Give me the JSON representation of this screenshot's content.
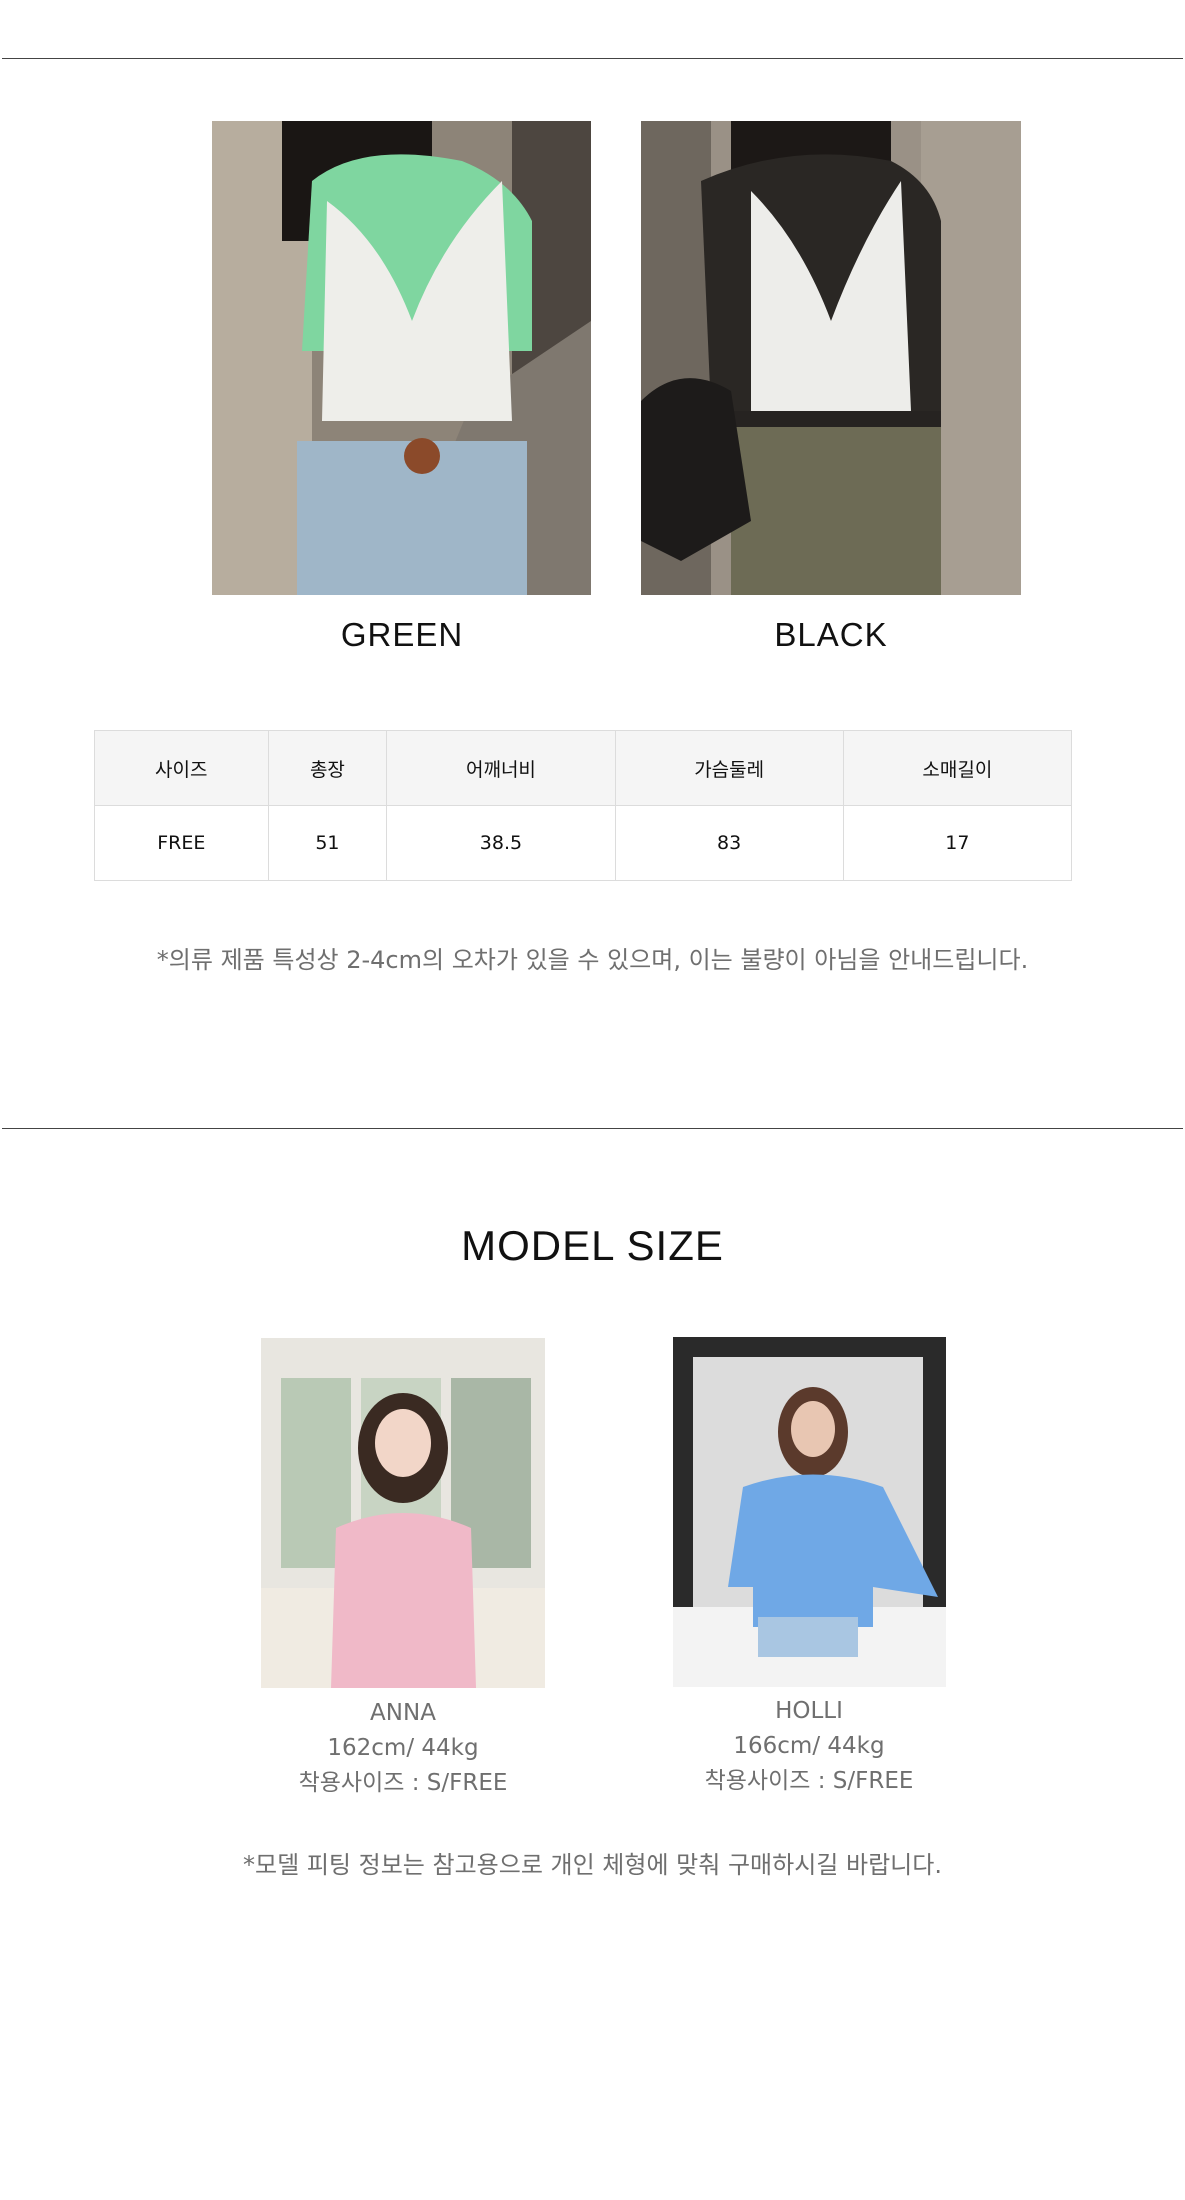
{
  "colors": [
    {
      "label": "GREEN",
      "swatch": "#6fd99b"
    },
    {
      "label": "BLACK",
      "swatch": "#222222"
    }
  ],
  "size_table": {
    "headers": [
      "사이즈",
      "총장",
      "어깨너비",
      "가슴둘레",
      "소매길이"
    ],
    "rows": [
      [
        "FREE",
        "51",
        "38.5",
        "83",
        "17"
      ]
    ]
  },
  "size_notice": "*의류 제품 특성상 2-4cm의 오차가 있을 수 있으며, 이는 불량이 아님을 안내드립니다.",
  "model_section": {
    "title": "MODEL SIZE",
    "models": [
      {
        "name": "ANNA",
        "body": "162cm/ 44kg",
        "size": "착용사이즈 : S/FREE"
      },
      {
        "name": "HOLLI",
        "body": "166cm/ 44kg",
        "size": "착용사이즈 : S/FREE"
      }
    ],
    "notice": "*모델 피팅 정보는 참고용으로 개인 체형에 맞춰 구매하시길 바랍니다."
  }
}
